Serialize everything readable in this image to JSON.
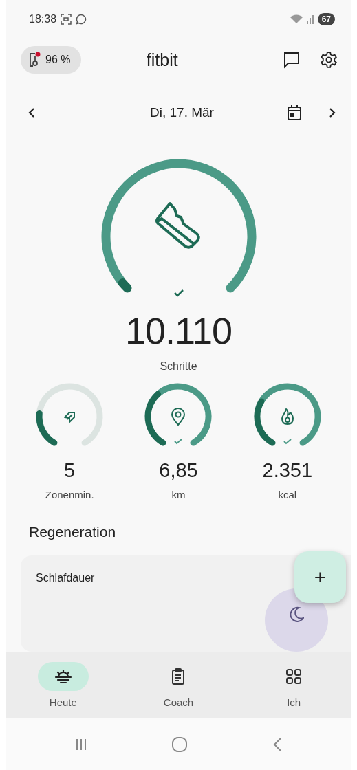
{
  "status_bar": {
    "time": "18:38",
    "battery": "67"
  },
  "header": {
    "device_battery": "96 %",
    "device_alert": true,
    "title": "fitbit"
  },
  "date_nav": {
    "date": "Di, 17. Mär"
  },
  "steps": {
    "value": "10.110",
    "label": "Schritte",
    "goal_reached": true
  },
  "stats": [
    {
      "value": "5",
      "label": "Zonenmin.",
      "goal_reached": false
    },
    {
      "value": "6,85",
      "label": "km",
      "goal_reached": true
    },
    {
      "value": "2.351",
      "label": "kcal",
      "goal_reached": true
    }
  ],
  "section_title": "Regeneration",
  "card": {
    "title": "Schlafdauer"
  },
  "fab": {
    "label": "+"
  },
  "tabs": [
    {
      "label": "Heute",
      "selected": true
    },
    {
      "label": "Coach",
      "selected": false
    },
    {
      "label": "Ich",
      "selected": false
    }
  ]
}
